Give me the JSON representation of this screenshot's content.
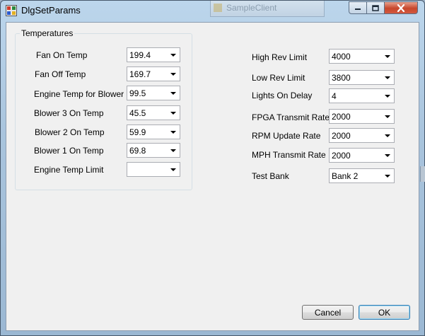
{
  "window": {
    "title": "DlgSetParams",
    "background_title": "SampleClient"
  },
  "colors": {
    "close_button": "#c7472b",
    "titlebar": "#bcd6ec",
    "dialog_bg": "#f0f0f0"
  },
  "group": {
    "title": "Temperatures",
    "fields": [
      {
        "label": "Fan On Temp",
        "value": "199.4"
      },
      {
        "label": "Fan Off Temp",
        "value": "169.7"
      },
      {
        "label": "Engine Temp for Blower",
        "value": "99.5"
      },
      {
        "label": "Blower 3 On Temp",
        "value": "45.5"
      },
      {
        "label": "Blower 2 On Temp",
        "value": "59.9"
      },
      {
        "label": "Blower 1 On Temp",
        "value": "69.8"
      },
      {
        "label": "Engine Temp Limit",
        "value": ""
      }
    ]
  },
  "right_fields": [
    {
      "label": "High Rev Limit",
      "value": "4000"
    },
    {
      "label": "Low Rev Limit",
      "value": "3800"
    },
    {
      "label": "Lights On Delay",
      "value": "4"
    },
    {
      "label": "FPGA Transmit Rate",
      "value": "2000"
    },
    {
      "label": "RPM Update Rate",
      "value": "2000"
    },
    {
      "label": "MPH Transmit Rate",
      "value": "2000"
    },
    {
      "label": "Test Bank",
      "value": "Bank 2"
    }
  ],
  "buttons": {
    "cancel": "Cancel",
    "ok": "OK"
  }
}
